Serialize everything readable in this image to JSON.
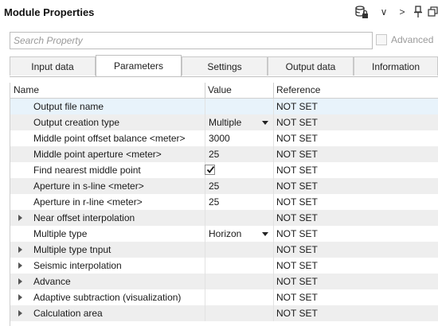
{
  "window": {
    "title": "Module Properties"
  },
  "toolbar": {
    "chevron_down": "∨",
    "chevron_right": ">"
  },
  "search": {
    "placeholder": "Search Property",
    "value": "",
    "advanced_label": "Advanced",
    "advanced_checked": false
  },
  "tabs": [
    {
      "label": "Input data",
      "active": false
    },
    {
      "label": "Parameters",
      "active": true
    },
    {
      "label": "Settings",
      "active": false
    },
    {
      "label": "Output data",
      "active": false
    },
    {
      "label": "Information",
      "active": false
    }
  ],
  "grid": {
    "columns": {
      "name": "Name",
      "value": "Value",
      "reference": "Reference"
    },
    "rows": [
      {
        "name": "Output file name",
        "value": "",
        "reference": "NOT SET"
      },
      {
        "name": "Output creation type",
        "value": "Multiple",
        "reference": "NOT SET",
        "dropdown": true
      },
      {
        "name": "Middle point offset balance <meter>",
        "value": "3000",
        "reference": "NOT SET"
      },
      {
        "name": "Middle point aperture <meter>",
        "value": "25",
        "reference": "NOT SET"
      },
      {
        "name": "Find nearest middle point",
        "value": "",
        "reference": "NOT SET",
        "checkbox": true,
        "checked": true
      },
      {
        "name": "Aperture in s-line <meter>",
        "value": "25",
        "reference": "NOT SET"
      },
      {
        "name": "Aperture in r-line <meter>",
        "value": "25",
        "reference": "NOT SET"
      },
      {
        "name": "Near offset interpolation",
        "value": "",
        "reference": "NOT SET",
        "expandable": true
      },
      {
        "name": "Multiple type",
        "value": "Horizon",
        "reference": "NOT SET",
        "dropdown": true
      },
      {
        "name": "Multiple type tnput",
        "value": "",
        "reference": "NOT SET",
        "expandable": true
      },
      {
        "name": "Seismic interpolation",
        "value": "",
        "reference": "NOT SET",
        "expandable": true
      },
      {
        "name": "Advance",
        "value": "",
        "reference": "NOT SET",
        "expandable": true
      },
      {
        "name": "Adaptive subtraction (visualization)",
        "value": "",
        "reference": "NOT SET",
        "expandable": true
      },
      {
        "name": "Calculation area",
        "value": "",
        "reference": "NOT SET",
        "expandable": true
      }
    ]
  }
}
